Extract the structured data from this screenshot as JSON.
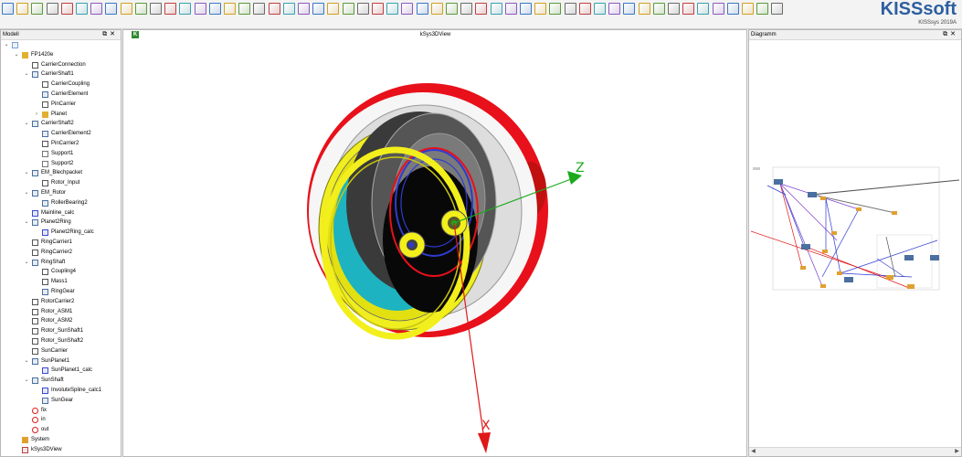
{
  "app": {
    "logo": "KISSsoft",
    "version": "KISSsys 2019A"
  },
  "colors": {
    "accent": "#2d5fa0",
    "gear_red": "#e01818",
    "gear_yellow": "#f2ef1c",
    "gear_cyan": "#1fb8c6",
    "gear_blue": "#2f3bd0",
    "axis_green": "#1aaa1a"
  },
  "panels": {
    "model": {
      "title": "Modell"
    },
    "view3d": {
      "title": "kSys3DView"
    },
    "diagram": {
      "title": "Diagramm"
    }
  },
  "axes": {
    "z": "Z",
    "x": "X"
  },
  "tree": [
    {
      "label": "",
      "icon": "root-folder-icon",
      "depth": 0,
      "expand": "open"
    },
    {
      "label": "FP1420e",
      "icon": "folder-icon",
      "depth": 1,
      "expand": "open"
    },
    {
      "label": "CarrierConnection",
      "icon": "connection-icon",
      "depth": 2,
      "expand": "none"
    },
    {
      "label": "CarrierShaft1",
      "icon": "shaft-icon",
      "depth": 2,
      "expand": "open"
    },
    {
      "label": "CarrierCoupling",
      "icon": "coupling-icon",
      "depth": 3,
      "expand": "none"
    },
    {
      "label": "CarrierElement",
      "icon": "element-icon",
      "depth": 3,
      "expand": "none"
    },
    {
      "label": "PinCarrier",
      "icon": "pin-icon",
      "depth": 3,
      "expand": "none"
    },
    {
      "label": "Planet",
      "icon": "folder-icon",
      "depth": 3,
      "expand": "closed"
    },
    {
      "label": "CarrierShaft2",
      "icon": "shaft-icon",
      "depth": 2,
      "expand": "open"
    },
    {
      "label": "CarrierElement2",
      "icon": "element-icon",
      "depth": 3,
      "expand": "none"
    },
    {
      "label": "PinCarrier2",
      "icon": "pin-icon",
      "depth": 3,
      "expand": "none"
    },
    {
      "label": "Support1",
      "icon": "support-icon",
      "depth": 3,
      "expand": "none"
    },
    {
      "label": "Support2",
      "icon": "support-icon",
      "depth": 3,
      "expand": "none"
    },
    {
      "label": "EM_Blechpacket",
      "icon": "shaft-icon",
      "depth": 2,
      "expand": "open"
    },
    {
      "label": "Rotor_Input",
      "icon": "coupling-icon",
      "depth": 3,
      "expand": "none"
    },
    {
      "label": "EM_Rotor",
      "icon": "shaft-icon",
      "depth": 2,
      "expand": "open"
    },
    {
      "label": "RollerBearing2",
      "icon": "bearing-icon",
      "depth": 3,
      "expand": "none"
    },
    {
      "label": "Mainline_calc",
      "icon": "calc-icon",
      "depth": 2,
      "expand": "none"
    },
    {
      "label": "Planet2Ring",
      "icon": "gearpair-icon",
      "depth": 2,
      "expand": "open"
    },
    {
      "label": "Planet2Ring_calc",
      "icon": "calc-icon",
      "depth": 3,
      "expand": "none"
    },
    {
      "label": "RingCarrier1",
      "icon": "table-icon",
      "depth": 2,
      "expand": "none"
    },
    {
      "label": "RingCarrier2",
      "icon": "table-icon",
      "depth": 2,
      "expand": "none"
    },
    {
      "label": "RingShaft",
      "icon": "shaft-icon",
      "depth": 2,
      "expand": "open"
    },
    {
      "label": "Coupling4",
      "icon": "coupling-icon",
      "depth": 3,
      "expand": "none"
    },
    {
      "label": "Mass1",
      "icon": "mass-icon",
      "depth": 3,
      "expand": "none"
    },
    {
      "label": "RingGear",
      "icon": "element-icon",
      "depth": 3,
      "expand": "none"
    },
    {
      "label": "RotorCarrier2",
      "icon": "table-icon",
      "depth": 2,
      "expand": "none"
    },
    {
      "label": "Rotor_ASM1",
      "icon": "connection-icon",
      "depth": 2,
      "expand": "none"
    },
    {
      "label": "Rotor_ASM2",
      "icon": "connection-icon",
      "depth": 2,
      "expand": "none"
    },
    {
      "label": "Rotor_SunShaft1",
      "icon": "connection-icon",
      "depth": 2,
      "expand": "none"
    },
    {
      "label": "Rotor_SunShaft2",
      "icon": "connection-icon",
      "depth": 2,
      "expand": "none"
    },
    {
      "label": "SunCarrier",
      "icon": "table-icon",
      "depth": 2,
      "expand": "none"
    },
    {
      "label": "SunPlanet1",
      "icon": "gearpair-icon",
      "depth": 2,
      "expand": "open"
    },
    {
      "label": "SunPlanet1_calc",
      "icon": "calc-icon",
      "depth": 3,
      "expand": "none"
    },
    {
      "label": "SunShaft",
      "icon": "shaft-icon",
      "depth": 2,
      "expand": "open"
    },
    {
      "label": "InvoluteSpline_calc1",
      "icon": "spline-icon",
      "depth": 3,
      "expand": "none"
    },
    {
      "label": "SunGear",
      "icon": "element-icon",
      "depth": 3,
      "expand": "none"
    },
    {
      "label": "fix",
      "icon": "constraint-icon",
      "depth": 2,
      "expand": "none"
    },
    {
      "label": "in",
      "icon": "constraint-icon",
      "depth": 2,
      "expand": "none"
    },
    {
      "label": "out",
      "icon": "constraint-icon",
      "depth": 2,
      "expand": "none"
    },
    {
      "label": "System",
      "icon": "system-icon",
      "depth": 1,
      "expand": "none"
    },
    {
      "label": "kSys3DView",
      "icon": "view3d-icon",
      "depth": 1,
      "expand": "none"
    }
  ],
  "toolbar_icons": [
    "new-icon",
    "open-icon",
    "save-icon",
    "edit-icon",
    "print-icon",
    "lock-icon",
    "calc-icon",
    "grid-icon",
    "select-icon",
    "connect-icon",
    "rotate-icon",
    "variation-icon",
    "sum-icon",
    "chart-icon",
    "chart2-icon",
    "chart3-icon",
    "colors-icon",
    "shapes-icon",
    "measure-icon",
    "tools-icon",
    "bulb-icon",
    "doc-icon",
    "move-icon",
    "copy-icon",
    "paste-icon",
    "group-icon",
    "table-icon",
    "table2-icon",
    "table3-icon",
    "list-icon",
    "print2-icon",
    "text-icon",
    "text2-icon",
    "cut-icon",
    "align-left-icon",
    "align-center-icon",
    "align-right-icon",
    "align-just-icon",
    "scale-icon",
    "zoom-icon",
    "view-icon",
    "cube1-icon",
    "cube2-icon",
    "cube3-icon",
    "cube4-icon",
    "cube5-icon",
    "cube6-icon",
    "cube7-icon",
    "cube8-icon",
    "gem1-icon",
    "gem2-icon",
    "gem3-icon",
    "gem4-icon"
  ]
}
